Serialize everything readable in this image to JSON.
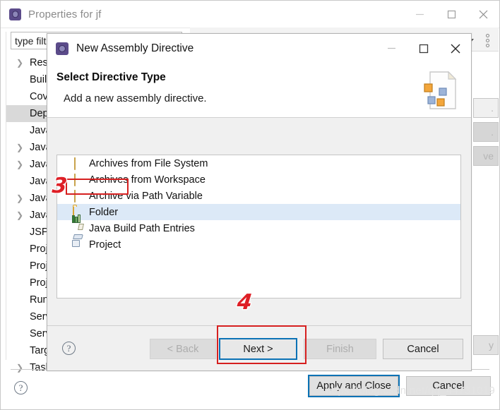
{
  "main_window": {
    "title": "Properties for jf",
    "icon": "eclipse-icon",
    "window_controls": {
      "minimize": "minimize-icon",
      "maximize": "maximize-icon",
      "close": "close-icon"
    },
    "filter": {
      "value": "type filt",
      "placeholder": "type filter text"
    },
    "tree_items": [
      {
        "label": "Reso",
        "expandable": true,
        "selected": false
      },
      {
        "label": "Build",
        "expandable": false,
        "selected": false
      },
      {
        "label": "Cove",
        "expandable": false,
        "selected": false
      },
      {
        "label": "Depl",
        "expandable": false,
        "selected": true
      },
      {
        "label": "Java ",
        "expandable": false,
        "selected": false
      },
      {
        "label": "Java ",
        "expandable": true,
        "selected": false
      },
      {
        "label": "Java ",
        "expandable": true,
        "selected": false
      },
      {
        "label": "Javad",
        "expandable": false,
        "selected": false
      },
      {
        "label": "Java ",
        "expandable": true,
        "selected": false
      },
      {
        "label": "JavaS",
        "expandable": true,
        "selected": false
      },
      {
        "label": "JSP F",
        "expandable": false,
        "selected": false
      },
      {
        "label": "Proje",
        "expandable": false,
        "selected": false
      },
      {
        "label": "Proje",
        "expandable": false,
        "selected": false
      },
      {
        "label": "Proje",
        "expandable": false,
        "selected": false
      },
      {
        "label": "Run/",
        "expandable": false,
        "selected": false
      },
      {
        "label": "Serve",
        "expandable": false,
        "selected": false
      },
      {
        "label": "Servi",
        "expandable": false,
        "selected": false
      },
      {
        "label": "Targe",
        "expandable": false,
        "selected": false
      },
      {
        "label": "Task",
        "expandable": true,
        "selected": false
      }
    ],
    "right_partial_buttons": [
      {
        "label": "."
      },
      {
        "label": "."
      },
      {
        "label": "ve"
      },
      {
        "label": "y"
      }
    ],
    "footer": {
      "help_icon": "help-icon",
      "apply_and_close": "Apply and Close",
      "cancel": "Cancel"
    },
    "watermark": "https://blog.csdn.net/qq_44731019"
  },
  "dialog": {
    "title": "New Assembly Directive",
    "icon": "eclipse-icon",
    "window_controls": {
      "minimize": "minimize-icon",
      "maximize": "maximize-icon",
      "close": "close-icon"
    },
    "header": {
      "title": "Select Directive Type",
      "subtitle": "Add a new assembly directive.",
      "banner_icon": "wizard-page-icon"
    },
    "list": [
      {
        "label": "Archives from File System",
        "icon": "jar-icon",
        "selected": false
      },
      {
        "label": "Archives from Workspace",
        "icon": "jar-icon",
        "selected": false
      },
      {
        "label": "Archive via Path Variable",
        "icon": "jar-icon",
        "selected": false
      },
      {
        "label": "Folder",
        "icon": "folder-icon",
        "selected": true
      },
      {
        "label": "Java Build Path Entries",
        "icon": "books-icon",
        "selected": false
      },
      {
        "label": "Project",
        "icon": "project-icon",
        "selected": false
      }
    ],
    "footer": {
      "help_icon": "help-icon",
      "back": "< Back",
      "next": "Next >",
      "finish": "Finish",
      "cancel": "Cancel"
    }
  },
  "annotations": [
    {
      "number": "3",
      "target": "folder-list-item"
    },
    {
      "number": "4",
      "target": "next-button"
    }
  ],
  "colors": {
    "accent": "#0b72b5",
    "annotation_red": "#d62020",
    "selection_blue": "#dce9f7",
    "dialog_bg": "#f0f0f0"
  }
}
